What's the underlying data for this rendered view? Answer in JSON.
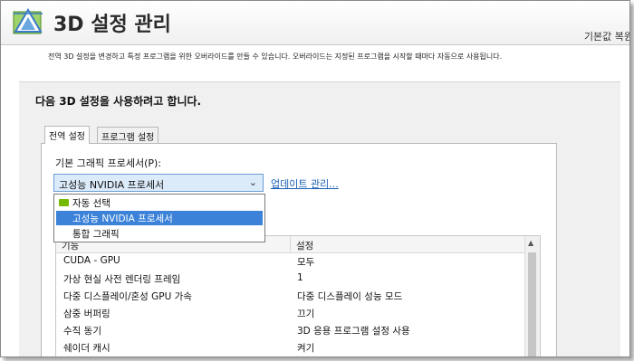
{
  "window": {
    "title": "3D 설정 관리",
    "restore_defaults": "기본값 복원"
  },
  "description": "전역 3D 설정을 변경하고 특정 프로그램을 위한 오버라이드를 만들 수 있습니다. 오버라이드는 지정된 프로그램을 시작할 때마다 자동으로 사용됩니다.",
  "section_heading": "다음 3D 설정을 사용하려고 합니다.",
  "tabs": [
    {
      "label": "전역 설정"
    },
    {
      "label": "프로그램 설정"
    }
  ],
  "preferred_processor": {
    "label": "기본 그래픽 프로세서(P):",
    "selected": "고성능 NVIDIA 프로세서",
    "options": [
      {
        "label": "자동 선택",
        "icon": "nvidia-icon"
      },
      {
        "label": "고성능 NVIDIA 프로세서"
      },
      {
        "label": "통합 그래픽"
      }
    ]
  },
  "update_link": "업데이트 관리...",
  "settings_table": {
    "headers": [
      "기능",
      "설정"
    ],
    "rows": [
      {
        "feature": "CUDA - GPU",
        "setting": "모두"
      },
      {
        "feature": "가상 현실 사전 렌더링 프레임",
        "setting": "1"
      },
      {
        "feature": "다중 디스플레이/혼성 GPU 가속",
        "setting": "다중 디스플레이 성능 모드"
      },
      {
        "feature": "삼중 버퍼링",
        "setting": "끄기"
      },
      {
        "feature": "수직 동기",
        "setting": "3D 응용 프로그램 설정 사용"
      },
      {
        "feature": "쉐이더 캐시",
        "setting": "켜기"
      }
    ]
  },
  "colors": {
    "accent": "#3b82d8",
    "link": "#1a5fb4",
    "nvidia_green": "#76b900"
  }
}
